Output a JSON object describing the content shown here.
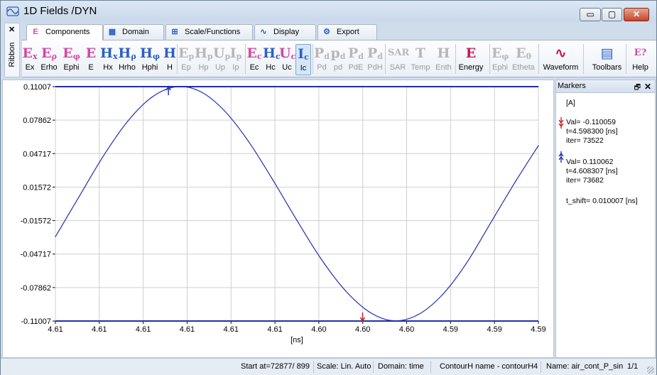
{
  "window": {
    "title": "1D Fields /DYN"
  },
  "window_buttons": {
    "minimize": "▭",
    "maximize": "▢",
    "close": "✕"
  },
  "ribbon": {
    "label": "Ribbon",
    "close": "✕"
  },
  "tabs": [
    {
      "label": "Components",
      "icon": "E",
      "icon_name": "components-icon"
    },
    {
      "label": "Domain",
      "icon": "▦",
      "icon_name": "domain-icon"
    },
    {
      "label": "Scale/Functions",
      "icon": "⊞",
      "icon_name": "scale-icon"
    },
    {
      "label": "Display",
      "icon": "∿",
      "icon_name": "display-icon"
    },
    {
      "label": "Export",
      "icon": "⚙",
      "icon_name": "export-icon"
    }
  ],
  "toolbar": {
    "buttons": [
      {
        "label": "Ex",
        "glyph": "E",
        "sub": "x",
        "color": "#d24aa0",
        "state": "enabled"
      },
      {
        "label": "Erho",
        "glyph": "E",
        "sub": "ρ",
        "color": "#d24aa0",
        "state": "enabled"
      },
      {
        "label": "Ephi",
        "glyph": "E",
        "sub": "φ",
        "color": "#d24aa0",
        "state": "enabled"
      },
      {
        "label": "E",
        "glyph": "E",
        "sub": "",
        "color": "#d24aa0",
        "state": "enabled"
      },
      {
        "label": "Hx",
        "glyph": "H",
        "sub": "x",
        "color": "#2c5fc6",
        "state": "enabled"
      },
      {
        "label": "Hrho",
        "glyph": "H",
        "sub": "ρ",
        "color": "#2c5fc6",
        "state": "enabled"
      },
      {
        "label": "Hphi",
        "glyph": "H",
        "sub": "φ",
        "color": "#2c5fc6",
        "state": "enabled"
      },
      {
        "label": "H",
        "glyph": "H",
        "sub": "",
        "color": "#2c5fc6",
        "state": "enabled"
      },
      {
        "label": "Ep",
        "glyph": "E",
        "sub": "p",
        "color": "#b7b7b7",
        "state": "disabled"
      },
      {
        "label": "Hp",
        "glyph": "H",
        "sub": "p",
        "color": "#b7b7b7",
        "state": "disabled"
      },
      {
        "label": "Up",
        "glyph": "U",
        "sub": "p",
        "color": "#b7b7b7",
        "state": "disabled"
      },
      {
        "label": "Ip",
        "glyph": "I",
        "sub": "p",
        "color": "#b7b7b7",
        "state": "disabled"
      },
      {
        "label": "Ec",
        "glyph": "E",
        "sub": "c",
        "color": "#d24aa0",
        "state": "enabled"
      },
      {
        "label": "Hc",
        "glyph": "H",
        "sub": "c",
        "color": "#2c5fc6",
        "state": "enabled"
      },
      {
        "label": "Uc",
        "glyph": "U",
        "sub": "c",
        "color": "#d24aa0",
        "state": "enabled"
      },
      {
        "label": "Ic",
        "glyph": "I",
        "sub": "c",
        "color": "#2c5fc6",
        "state": "selected"
      },
      {
        "label": "Pd",
        "glyph": "P",
        "sub": "d",
        "color": "#b7b7b7",
        "state": "disabled"
      },
      {
        "label": "pd",
        "glyph": "p",
        "sub": "d",
        "color": "#b7b7b7",
        "state": "disabled"
      },
      {
        "label": "PdE",
        "glyph": "P",
        "sub": "d",
        "color": "#b7b7b7",
        "state": "disabled"
      },
      {
        "label": "PdH",
        "glyph": "P",
        "sub": "d",
        "color": "#b7b7b7",
        "state": "disabled"
      },
      {
        "label": "SAR",
        "glyph": "SAR",
        "sub": "",
        "color": "#b7b7b7",
        "state": "disabled"
      },
      {
        "label": "Temp",
        "glyph": "T",
        "sub": "",
        "color": "#b7b7b7",
        "state": "disabled"
      },
      {
        "label": "Enth",
        "glyph": "H",
        "sub": "",
        "color": "#b7b7b7",
        "state": "disabled"
      },
      {
        "label": "Energy",
        "glyph": "E",
        "sub": "",
        "color": "#c8175d",
        "state": "enabled"
      },
      {
        "label": "Ephi",
        "glyph": "E",
        "sub": "φ",
        "color": "#b7b7b7",
        "state": "disabled"
      },
      {
        "label": "Etheta",
        "glyph": "E",
        "sub": "θ",
        "color": "#b7b7b7",
        "state": "disabled"
      },
      {
        "label": "Waveform",
        "glyph": "∿",
        "sub": "",
        "color": "#c8175d",
        "state": "enabled"
      },
      {
        "label": "Toolbars",
        "glyph": "▤",
        "sub": "",
        "color": "#2c5fc6",
        "state": "enabled"
      },
      {
        "label": "Help",
        "glyph": "E?",
        "sub": "",
        "color": "#d24aa0",
        "state": "enabled"
      }
    ]
  },
  "chart_data": {
    "type": "line",
    "title": "",
    "xlabel": "[ns]",
    "ylabel": "",
    "y_tick_labels": [
      "0.11007",
      "0.07862",
      "0.04717",
      "0.01572",
      "-0.01572",
      "-0.04717",
      "-0.07862",
      "-0.11007"
    ],
    "x_tick_labels": [
      "4.61",
      "4.61",
      "4.61",
      "4.61",
      "4.61",
      "4.61",
      "4.60",
      "4.60",
      "4.60",
      "4.59",
      "4.59",
      "4.59"
    ],
    "ylim": [
      -0.11007,
      0.11007
    ],
    "series": [
      {
        "color": "#1f2fb0",
        "x": [
          0.0,
          0.05,
          0.1,
          0.15,
          0.2,
          0.25,
          0.3,
          0.35,
          0.4,
          0.45,
          0.5,
          0.55,
          0.6,
          0.65,
          0.7,
          0.75,
          0.8,
          0.85,
          0.9,
          0.95,
          1.0
        ],
        "values": [
          -0.0309,
          0.0075,
          0.0454,
          0.0777,
          0.1002,
          0.11,
          0.1055,
          0.0874,
          0.0585,
          0.0226,
          -0.0155,
          -0.0517,
          -0.0813,
          -0.1015,
          -0.1098,
          -0.1043,
          -0.086,
          -0.0565,
          -0.0188,
          0.0191,
          0.0547
        ]
      }
    ],
    "markers": [
      {
        "color": "#cc1f1f",
        "x": 0.636,
        "y": -0.110059,
        "direction": "down"
      },
      {
        "color": "#1f2fb0",
        "x": 0.234,
        "y": 0.110062,
        "direction": "up"
      }
    ],
    "grid": true
  },
  "markers_panel": {
    "title": "Markers",
    "pin": "🗗",
    "close": "✕",
    "group": "[A]",
    "marker1": {
      "val": "Val= -0.110059",
      "t": "t=4.598300 [ns]",
      "iter": "iter= 73522",
      "color": "#cc1f1f"
    },
    "marker2": {
      "val": "Val= 0.110062",
      "t": "t=4.608307 [ns]",
      "iter": "iter= 73682",
      "color": "#1f2fb0"
    },
    "t_shift": "t_shift= 0.010007 [ns]"
  },
  "statusbar": {
    "start": "Start at=72877/ 899",
    "scale": "Scale: Lin. Auto",
    "domain": "Domain: time",
    "contour": "ContourH name - contourH4",
    "name": "Name:  air_cont_P_sin",
    "page": "1/1"
  }
}
